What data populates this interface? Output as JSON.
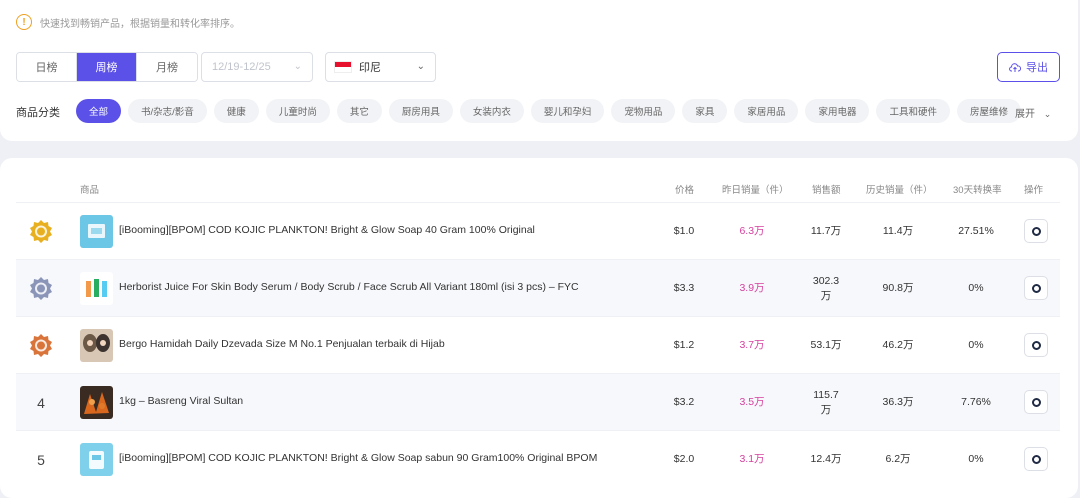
{
  "tip": {
    "text": "快速找到畅销产品，根据销量和转化率排序。"
  },
  "period_tabs": [
    {
      "label": "日榜",
      "active": false
    },
    {
      "label": "周榜",
      "active": true
    },
    {
      "label": "月榜",
      "active": false
    }
  ],
  "date_select": {
    "value": "12/19-12/25"
  },
  "country_select": {
    "value": "印尼",
    "flag_colors": [
      "#e8112d",
      "#ffffff"
    ]
  },
  "export_button": {
    "label": "导出"
  },
  "categories": {
    "label": "商品分类",
    "items": [
      {
        "label": "全部",
        "active": true
      },
      {
        "label": "书/杂志/影音"
      },
      {
        "label": "健康"
      },
      {
        "label": "儿童时尚"
      },
      {
        "label": "其它"
      },
      {
        "label": "厨房用具"
      },
      {
        "label": "女装内衣"
      },
      {
        "label": "婴儿和孕妇"
      },
      {
        "label": "宠物用品"
      },
      {
        "label": "家具"
      },
      {
        "label": "家居用品"
      },
      {
        "label": "家用电器"
      },
      {
        "label": "工具和硬件"
      },
      {
        "label": "房屋维修"
      }
    ],
    "expand_label": "展开"
  },
  "table": {
    "columns": {
      "product": "商品",
      "price": "价格",
      "yesterday_sales": "昨日销量（件）",
      "sales_amount": "销售额",
      "history_sales": "历史销量（件）",
      "conversion_30d": "30天转换率",
      "action": "操作"
    },
    "rows": [
      {
        "rank": "1",
        "medal": "gold",
        "name": "[iBooming][BPOM] COD KOJIC PLANKTON! Bright & Glow Soap 40 Gram 100% Original",
        "price": "$1.0",
        "yesterday_sales": "6.3万",
        "sales_amount": "11.7万",
        "history_sales": "11.4万",
        "conversion": "27.51%"
      },
      {
        "rank": "2",
        "medal": "silver",
        "name": "Herborist Juice For Skin Body Serum / Body Scrub / Face Scrub All Variant 180ml (isi 3 pcs) – FYC",
        "price": "$3.3",
        "yesterday_sales": "3.9万",
        "sales_amount": "302.3万",
        "history_sales": "90.8万",
        "conversion": "0%"
      },
      {
        "rank": "3",
        "medal": "bronze",
        "name": "Bergo Hamidah Daily Dzevada Size M No.1 Penjualan terbaik di Hijab",
        "price": "$1.2",
        "yesterday_sales": "3.7万",
        "sales_amount": "53.1万",
        "history_sales": "46.2万",
        "conversion": "0%"
      },
      {
        "rank": "4",
        "medal": "",
        "name": "1kg – Basreng Viral Sultan",
        "price": "$3.2",
        "yesterday_sales": "3.5万",
        "sales_amount": "115.7万",
        "history_sales": "36.3万",
        "conversion": "7.76%"
      },
      {
        "rank": "5",
        "medal": "",
        "name": "[iBooming][BPOM] COD KOJIC PLANKTON! Bright & Glow Soap sabun 90 Gram100% Original BPOM",
        "price": "$2.0",
        "yesterday_sales": "3.1万",
        "sales_amount": "12.4万",
        "history_sales": "6.2万",
        "conversion": "0%"
      }
    ]
  },
  "icons": {
    "tip": "exclamation-circle-icon",
    "chevron": "chevron-down-icon",
    "export": "cloud-upload-icon",
    "medal": "medal-icon",
    "action": "search-icon"
  },
  "colors": {
    "accent": "#5b50e8",
    "sales_highlight": "#d6409f",
    "medal_gold": "#e8b020",
    "medal_silver": "#8a95b8",
    "medal_bronze": "#d9743a"
  }
}
